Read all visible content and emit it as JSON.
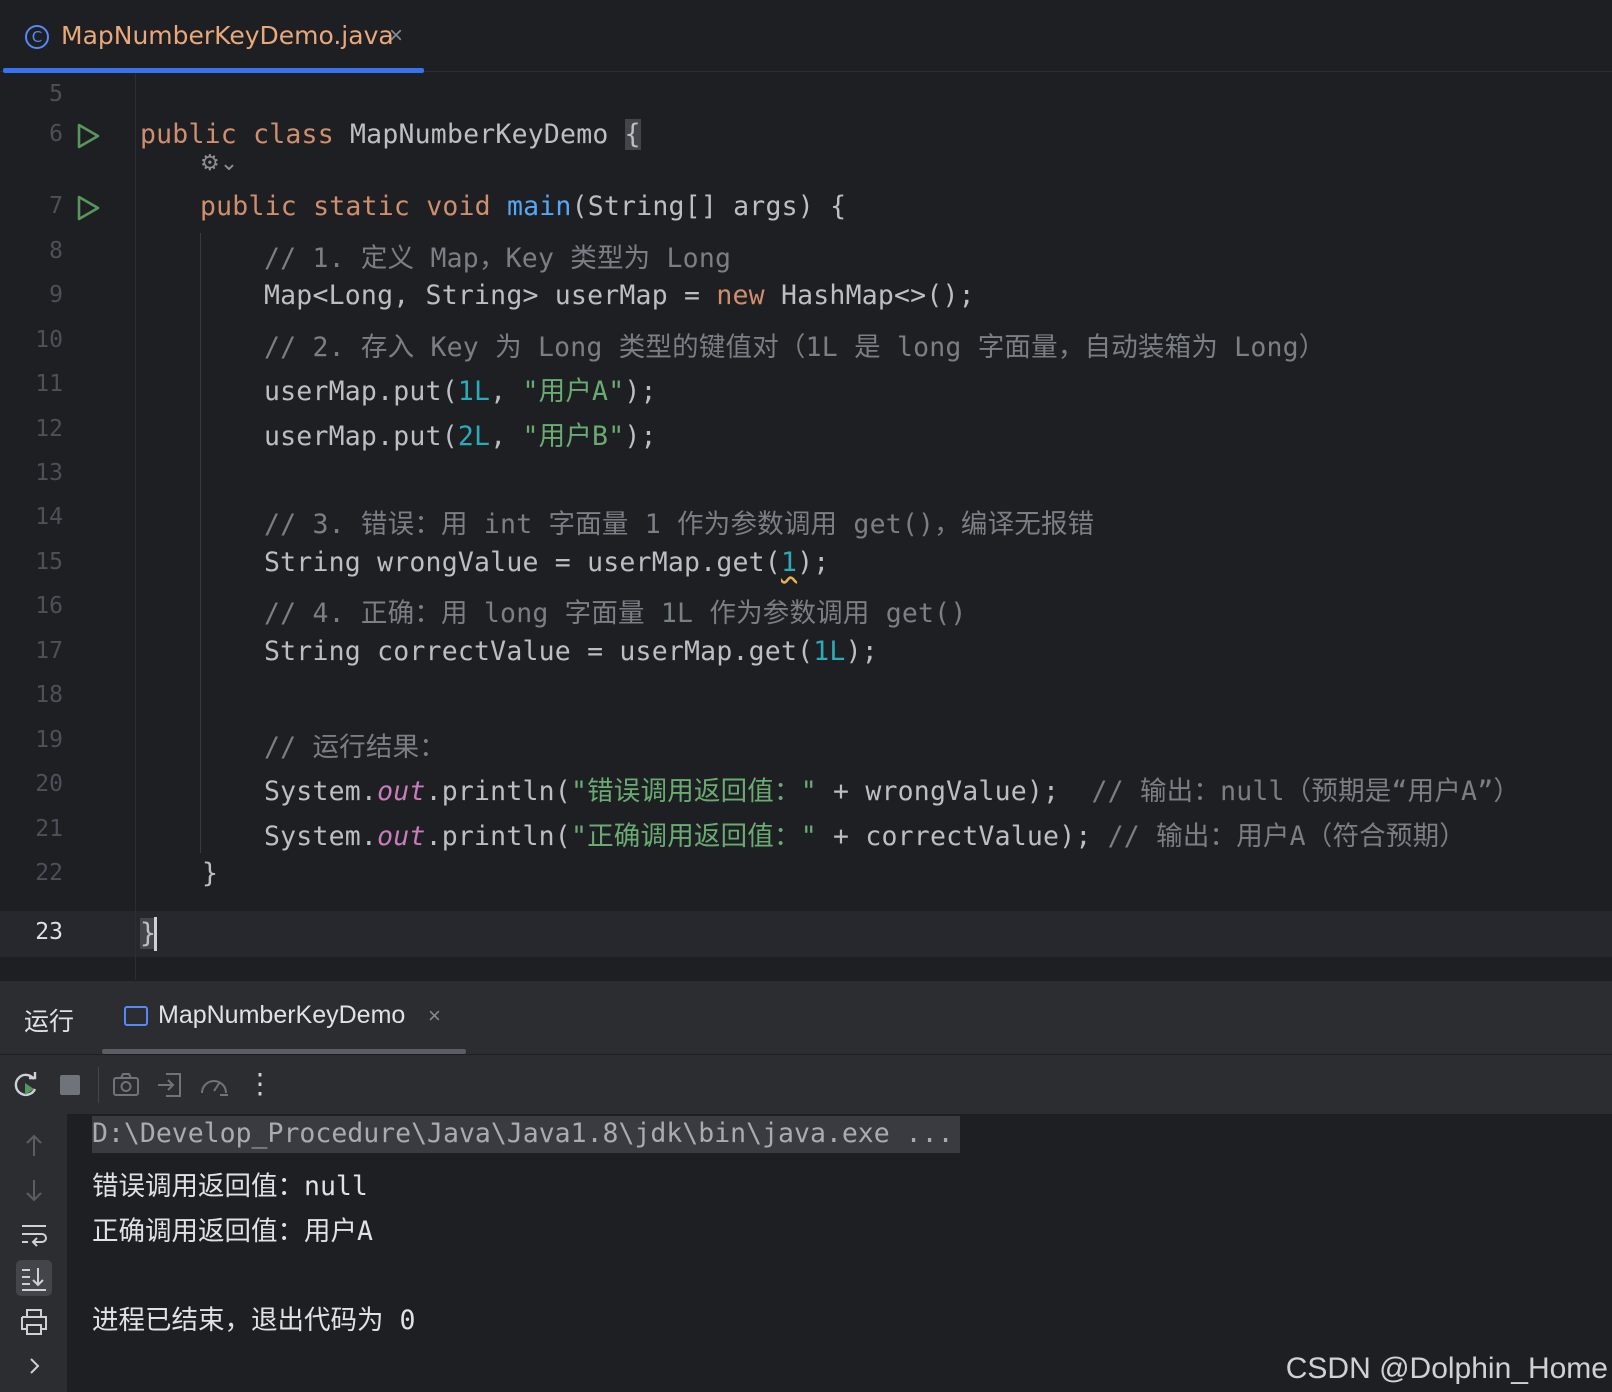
{
  "editor_tab": {
    "icon": "C",
    "title": "MapNumberKeyDemo.java",
    "close": "×"
  },
  "hint": {
    "icon": "⚙⌄"
  },
  "code_lines": [
    {
      "n": "5"
    },
    {
      "n": "6"
    },
    {
      "n": "7"
    },
    {
      "n": "8"
    },
    {
      "n": "9"
    },
    {
      "n": "10"
    },
    {
      "n": "11"
    },
    {
      "n": "12"
    },
    {
      "n": "13"
    },
    {
      "n": "14"
    },
    {
      "n": "15"
    },
    {
      "n": "16"
    },
    {
      "n": "17"
    },
    {
      "n": "18"
    },
    {
      "n": "19"
    },
    {
      "n": "20"
    },
    {
      "n": "21"
    },
    {
      "n": "22"
    },
    {
      "n": "23"
    }
  ],
  "code": {
    "l6_kw1": "public",
    "l6_kw2": "class",
    "l6_name": "MapNumberKeyDemo",
    "l6_brace": "{",
    "l7_kw1": "public",
    "l7_kw2": "static",
    "l7_kw3": "void",
    "l7_fn": "main",
    "l7_rest": "(String[] args) {",
    "l8": "// 1. 定义 Map，Key 类型为 Long",
    "l9_a": "Map<Long, String> userMap = ",
    "l9_kw": "new",
    "l9_b": " HashMap<>();",
    "l10": "// 2. 存入 Key 为 Long 类型的键值对（1L 是 long 字面量，自动装箱为 Long）",
    "l11_a": "userMap.put(",
    "l11_num": "1L",
    "l11_b": ", ",
    "l11_str": "\"用户A\"",
    "l11_c": ");",
    "l12_a": "userMap.put(",
    "l12_num": "2L",
    "l12_b": ", ",
    "l12_str": "\"用户B\"",
    "l12_c": ");",
    "l14": "// 3. 错误：用 int 字面量 1 作为参数调用 get()，编译无报错",
    "l15_a": "String wrongValue = userMap.get(",
    "l15_num": "1",
    "l15_b": ");",
    "l16": "// 4. 正确：用 long 字面量 1L 作为参数调用 get()",
    "l17_a": "String correctValue = userMap.get(",
    "l17_num": "1L",
    "l17_b": ");",
    "l19": "// 运行结果：",
    "l20_a": "System.",
    "l20_fld": "out",
    "l20_b": ".println(",
    "l20_str": "\"错误调用返回值：\"",
    "l20_c": " + wrongValue);  ",
    "l20_cmt": "// 输出：null（预期是“用户A”）",
    "l21_a": "System.",
    "l21_fld": "out",
    "l21_b": ".println(",
    "l21_str": "\"正确调用返回值：\"",
    "l21_c": " + correctValue); ",
    "l21_cmt": "// 输出：用户A（符合预期）",
    "l22": "}",
    "l23": "}"
  },
  "run_window": {
    "title": "运行",
    "tab_title": "MapNumberKeyDemo",
    "tab_close": "×",
    "more_icon": "⋮"
  },
  "console": {
    "cmd": "D:\\Develop_Procedure\\Java\\Java1.8\\jdk\\bin\\java.exe ...",
    "out1": "错误调用返回值：null",
    "out2": "正确调用返回值：用户A",
    "exit": "进程已结束，退出代码为 0"
  },
  "watermark": "CSDN @Dolphin_Home",
  "colors": {
    "keyword": "#cf8e6d",
    "function": "#56a8f5",
    "string": "#6aab73",
    "number": "#2aacb8",
    "comment": "#7a7e85",
    "field": "#c77dbb",
    "accent": "#3574f0"
  }
}
